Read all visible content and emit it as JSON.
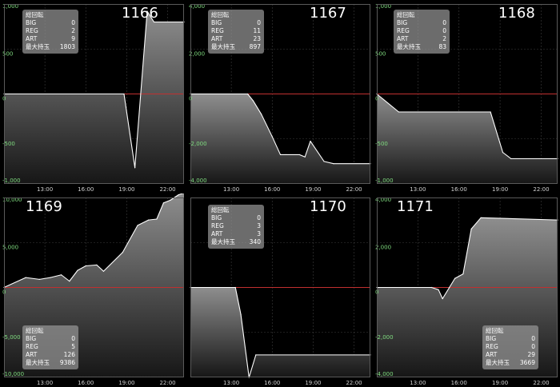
{
  "info_labels": {
    "total": "総回転",
    "big": "BIG",
    "reg": "REG",
    "art": "ART",
    "max": "最大持玉"
  },
  "x_ticks": [
    {
      "label": "13:00",
      "hour": 13
    },
    {
      "label": "16:00",
      "hour": 16
    },
    {
      "label": "19:00",
      "hour": 19
    },
    {
      "label": "22:00",
      "hour": 22
    }
  ],
  "colors": {
    "background": "#000000",
    "grid": "#3c3c3c",
    "zero_line": "#c03030",
    "series_line": "#ffffff",
    "y_label": "#7fdc7f",
    "x_label": "#d0d0d0"
  },
  "chart_data": [
    {
      "type": "area",
      "machine": "1166",
      "stats": {
        "big": "0",
        "reg": "2",
        "art": "9",
        "max": "1803"
      },
      "y_ticks": [
        {
          "label": "1,000",
          "value": 1000
        },
        {
          "label": "500",
          "value": 500
        },
        {
          "label": "0",
          "value": 0
        },
        {
          "label": "-500",
          "value": -500
        },
        {
          "label": "-1,000",
          "value": -1000
        }
      ],
      "ylim": [
        -1000,
        1000
      ],
      "xlim": [
        10,
        23.2
      ],
      "x": [
        10,
        18.8,
        19.6,
        20.5,
        21.0,
        23.2
      ],
      "y": [
        0,
        0,
        -820,
        920,
        800,
        800
      ]
    },
    {
      "type": "area",
      "machine": "1167",
      "stats": {
        "big": "0",
        "reg": "11",
        "art": "23",
        "max": "897"
      },
      "y_ticks": [
        {
          "label": "4,000",
          "value": 4000
        },
        {
          "label": "2,000",
          "value": 2000
        },
        {
          "label": "0",
          "value": 0
        },
        {
          "label": "-2,000",
          "value": -2000
        },
        {
          "label": "-4,000",
          "value": -4000
        }
      ],
      "ylim": [
        -4000,
        4000
      ],
      "xlim": [
        10,
        23.2
      ],
      "x": [
        10,
        14.2,
        14.6,
        15.2,
        16.0,
        16.6,
        17.0,
        18.0,
        18.4,
        18.8,
        19.8,
        20.5,
        23.2
      ],
      "y": [
        0,
        0,
        -300,
        -900,
        -1900,
        -2700,
        -2700,
        -2700,
        -2800,
        -2100,
        -3000,
        -3100,
        -3100
      ]
    },
    {
      "type": "area",
      "machine": "1168",
      "stats": {
        "big": "0",
        "reg": "0",
        "art": "2",
        "max": "83"
      },
      "y_ticks": [
        {
          "label": "1,000",
          "value": 1000
        },
        {
          "label": "500",
          "value": 500
        },
        {
          "label": "0",
          "value": 0
        },
        {
          "label": "-500",
          "value": -500
        },
        {
          "label": "-1,000",
          "value": -1000
        }
      ],
      "ylim": [
        -1000,
        1000
      ],
      "xlim": [
        10,
        23.2
      ],
      "x": [
        10,
        11.6,
        18.3,
        19.2,
        19.8,
        23.2
      ],
      "y": [
        0,
        -200,
        -200,
        -650,
        -720,
        -720
      ]
    },
    {
      "type": "area",
      "machine": "1169",
      "stats": {
        "big": "0",
        "reg": "5",
        "art": "126",
        "max": "9386"
      },
      "y_ticks": [
        {
          "label": "10,000",
          "value": 10000
        },
        {
          "label": "5,000",
          "value": 5000
        },
        {
          "label": "0",
          "value": 0
        },
        {
          "label": "-5,000",
          "value": -5000
        },
        {
          "label": "-10,000",
          "value": -10000
        }
      ],
      "ylim": [
        -10000,
        10000
      ],
      "xlim": [
        10,
        23.2
      ],
      "x": [
        10,
        11.6,
        12.6,
        13.4,
        14.2,
        14.8,
        15.4,
        16.0,
        16.8,
        17.3,
        18.7,
        19.8,
        20.6,
        21.2,
        21.7,
        22.2,
        22.8,
        23.2
      ],
      "y": [
        0,
        1100,
        900,
        1100,
        1400,
        700,
        1900,
        2400,
        2500,
        1800,
        3900,
        6900,
        7500,
        7600,
        9400,
        9700,
        10300,
        10500
      ]
    },
    {
      "type": "area",
      "machine": "1170",
      "stats": {
        "big": "0",
        "reg": "3",
        "art": "3",
        "max": "340"
      },
      "y_ticks": [],
      "ylim": [
        -1000,
        1000
      ],
      "xlim": [
        10,
        23.2
      ],
      "x": [
        10,
        13.3,
        13.7,
        14.3,
        14.8,
        23.2
      ],
      "y": [
        0,
        0,
        -300,
        -1000,
        -750,
        -750
      ]
    },
    {
      "type": "area",
      "machine": "1171",
      "stats": {
        "big": "0",
        "reg": "0",
        "art": "29",
        "max": "3669"
      },
      "y_ticks": [
        {
          "label": "4,000",
          "value": 4000
        },
        {
          "label": "2,000",
          "value": 2000
        },
        {
          "label": "0",
          "value": 0
        },
        {
          "label": "-2,000",
          "value": -2000
        },
        {
          "label": "-4,000",
          "value": -4000
        }
      ],
      "ylim": [
        -4000,
        4000
      ],
      "xlim": [
        10,
        23.2
      ],
      "x": [
        10,
        14.0,
        14.5,
        14.8,
        15.3,
        15.7,
        16.3,
        16.9,
        17.6,
        23.2
      ],
      "y": [
        0,
        0,
        -100,
        -500,
        0,
        400,
        600,
        2600,
        3100,
        3000
      ]
    }
  ]
}
